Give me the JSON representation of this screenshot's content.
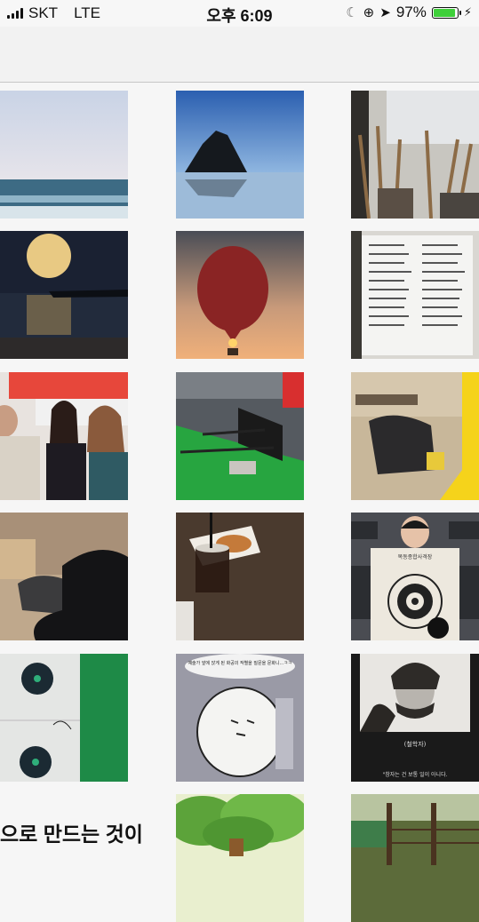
{
  "status_bar": {
    "carrier": "SKT",
    "network": "LTE",
    "time": "오후 6:09",
    "battery": "97%",
    "battery_level": 0.97,
    "accent_battery": "#3fd03a"
  },
  "grid": {
    "photos": [
      {
        "id": "sea-horizon"
      },
      {
        "id": "haystack-rock-beach"
      },
      {
        "id": "paint-brushes"
      },
      {
        "id": "full-moon-sea"
      },
      {
        "id": "flower-balloon"
      },
      {
        "id": "menu-board"
      },
      {
        "id": "selfie-three-people"
      },
      {
        "id": "shooting-range-lanes"
      },
      {
        "id": "yellow-room"
      },
      {
        "id": "legs-bag-floor"
      },
      {
        "id": "iced-coffee-table"
      },
      {
        "id": "man-holding-target"
      },
      {
        "id": "paper-targets"
      },
      {
        "id": "cartoon-drawing"
      },
      {
        "id": "philosopher-portrait"
      },
      {
        "id": "tree-cartoon"
      },
      {
        "id": "fence-garden"
      }
    ],
    "target_text_1": "목동종합사격장",
    "cartoon_text": "예술가 앞에 앉게 된 화공의 작별을 질문을 문화니...ㅋㅋ",
    "portrait_label": "(철학자)",
    "portrait_quote": "\"창자는 건 보통 일이 아니다."
  },
  "caption": "으로 만드는 것이"
}
